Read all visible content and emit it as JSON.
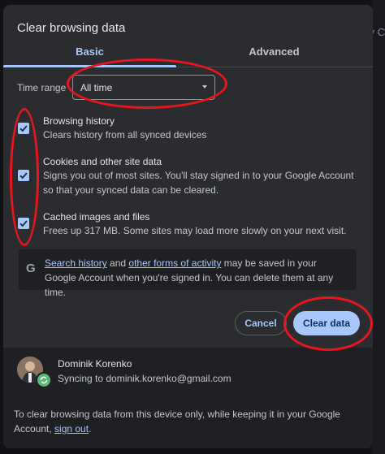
{
  "background": {
    "peek_text": "ry C"
  },
  "dialog": {
    "title": "Clear browsing data",
    "tabs": [
      {
        "label": "Basic",
        "selected": true
      },
      {
        "label": "Advanced",
        "selected": false
      }
    ],
    "time_range": {
      "label": "Time range",
      "value": "All time"
    },
    "options": [
      {
        "title": "Browsing history",
        "description": "Clears history from all synced devices",
        "checked": true
      },
      {
        "title": "Cookies and other site data",
        "description": "Signs you out of most sites. You'll stay signed in to your Google Account so that your synced data can be cleared.",
        "checked": true
      },
      {
        "title": "Cached images and files",
        "description": "Frees up 317 MB. Some sites may load more slowly on your next visit.",
        "checked": true
      }
    ],
    "info": {
      "icon": "google-g-icon",
      "link1": "Search history",
      "and": " and ",
      "link2": "other forms of activity",
      "rest": " may be saved in your Google Account when you're signed in. You can delete them at any time."
    },
    "buttons": {
      "cancel": "Cancel",
      "clear": "Clear data"
    },
    "account": {
      "name": "Dominik Korenko",
      "sync_status": "Syncing to dominik.korenko@gmail.com"
    },
    "footer": {
      "text": "To clear browsing data from this device only, while keeping it in your Google Account, ",
      "link": "sign out",
      "end": "."
    }
  },
  "colors": {
    "accent": "#a8c7fa",
    "dialog_bg": "#2b2c2f",
    "annotation": "#e8141e"
  }
}
